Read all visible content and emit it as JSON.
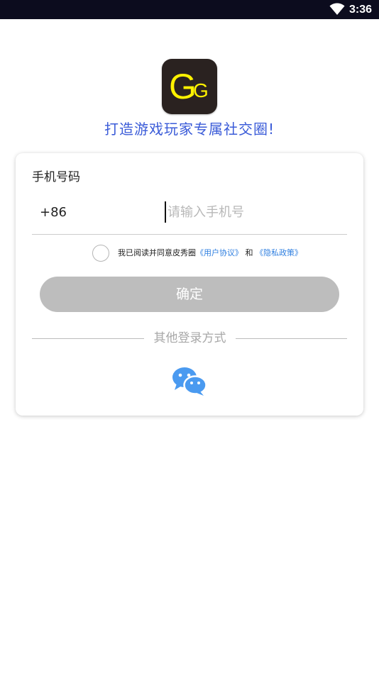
{
  "status_bar": {
    "time": "3:36",
    "wifi_icon": "wifi-icon"
  },
  "logo": {
    "letter_large": "G",
    "letter_small": "G",
    "background_color": "#2a2220",
    "letter_color": "#fff200"
  },
  "slogan": "打造游戏玩家专属社交圈!",
  "login_form": {
    "phone_label": "手机号码",
    "country_code": "+86",
    "phone_input": {
      "value": "",
      "placeholder": "请输入手机号"
    },
    "agreement": {
      "checked": false,
      "text_prefix": "我已阅读并同意皮秀圈",
      "user_agreement_link": "《用户协议》",
      "conjunction": "和",
      "privacy_policy_link": "《隐私政策》"
    },
    "confirm_button": "确定",
    "other_login_label": "其他登录方式",
    "wechat_icon": "wechat-icon"
  },
  "colors": {
    "accent": "#3a5bd8",
    "link": "#2f7fe0",
    "button_disabled": "#bdbdbd",
    "wechat": "#4a9af0"
  }
}
